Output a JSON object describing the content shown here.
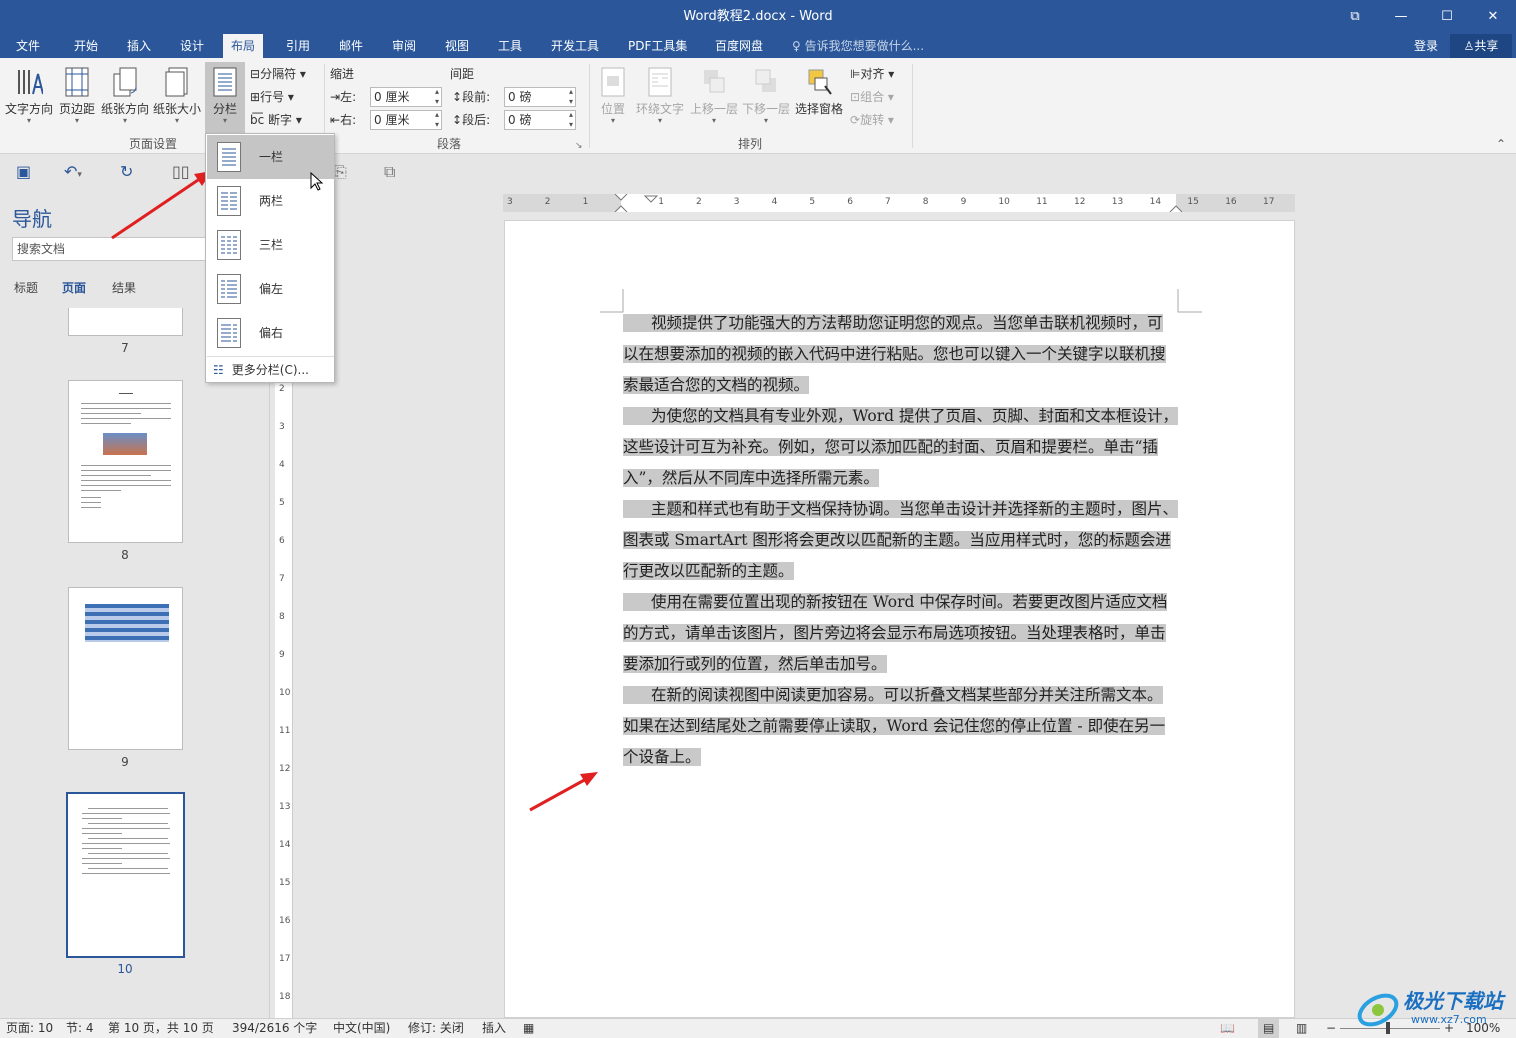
{
  "window": {
    "title": "Word教程2.docx - Word"
  },
  "tabs": [
    "文件",
    "开始",
    "插入",
    "设计",
    "布局",
    "引用",
    "邮件",
    "审阅",
    "视图",
    "工具",
    "开发工具",
    "PDF工具集",
    "百度网盘"
  ],
  "tell_me": "告诉我您想要做什么...",
  "login": "登录",
  "share": "共享",
  "ribbon": {
    "page_setup": {
      "text_direction": "文字方向",
      "margins": "页边距",
      "orientation": "纸张方向",
      "size": "纸张大小",
      "columns": "分栏",
      "breaks": "分隔符",
      "line_numbers": "行号",
      "hyphenation": "断字",
      "label": "页面设置"
    },
    "paragraph": {
      "indent": "缩进",
      "spacing": "间距",
      "left_label": "左:",
      "left_value": "0 厘米",
      "right_label": "右:",
      "right_value": "0 厘米",
      "before_label": "段前:",
      "before_value": "0 磅",
      "after_label": "段后:",
      "after_value": "0 磅",
      "label": "段落"
    },
    "arrange": {
      "position": "位置",
      "wrap": "环绕文字",
      "forward": "上移一层",
      "backward": "下移一层",
      "pane": "选择窗格",
      "align": "对齐",
      "group": "组合",
      "rotate": "旋转",
      "label": "排列"
    }
  },
  "columns_menu": {
    "items": [
      "一栏",
      "两栏",
      "三栏",
      "偏左",
      "偏右"
    ],
    "more": "更多分栏(C)..."
  },
  "nav": {
    "title": "导航",
    "search_placeholder": "搜索文档",
    "tabs": [
      "标题",
      "页面",
      "结果"
    ],
    "pages": [
      "7",
      "8",
      "9",
      "10"
    ]
  },
  "document": {
    "paragraphs": [
      {
        "lines": [
          "视频提供了功能强大的方法帮助您证明您的观点。当您单击联机视频时，可",
          "以在想要添加的视频的嵌入代码中进行粘贴。您也可以键入一个关键字以联机搜",
          "索最适合您的文档的视频。"
        ]
      },
      {
        "lines": [
          "为使您的文档具有专业外观，Word 提供了页眉、页脚、封面和文本框设计，",
          "这些设计可互为补充。例如，您可以添加匹配的封面、页眉和提要栏。单击“插",
          "入”，然后从不同库中选择所需元素。"
        ]
      },
      {
        "lines": [
          "主题和样式也有助于文档保持协调。当您单击设计并选择新的主题时，图片、",
          "图表或 SmartArt 图形将会更改以匹配新的主题。当应用样式时，您的标题会进",
          "行更改以匹配新的主题。"
        ]
      },
      {
        "lines": [
          "使用在需要位置出现的新按钮在 Word 中保存时间。若要更改图片适应文档",
          "的方式，请单击该图片，图片旁边将会显示布局选项按钮。当处理表格时，单击",
          "要添加行或列的位置，然后单击加号。"
        ]
      },
      {
        "lines": [
          "在新的阅读视图中阅读更加容易。可以折叠文档某些部分并关注所需文本。",
          "如果在达到结尾处之前需要停止读取，Word 会记住您的停止位置 - 即使在另一",
          "个设备上。"
        ]
      }
    ]
  },
  "status": {
    "page": "页面: 10",
    "section": "节: 4",
    "page_of": "第 10 页，共 10 页",
    "words": "394/2616 个字",
    "lang": "中文(中国)",
    "track": "修订: 关闭",
    "insert": "插入",
    "zoom": "100%"
  },
  "watermark": {
    "text": "极光下载站",
    "url": "www.xz7.com"
  },
  "colors": {
    "accent": "#2b579a",
    "selection": "#c9c9c9",
    "arrow": "#e02020"
  }
}
